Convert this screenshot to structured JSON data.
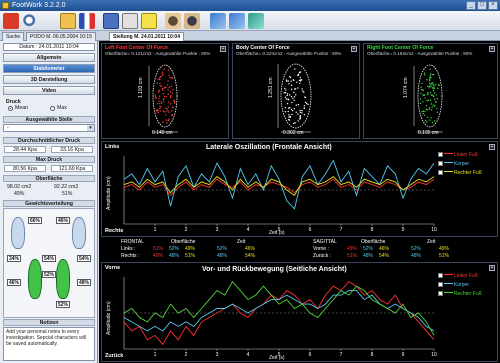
{
  "window": {
    "title": "FootWork 3.2.2.0"
  },
  "toolbar": {
    "icons": [
      "exit-icon",
      "search-icon",
      "folder-icon",
      "flag-icon",
      "disk-icon",
      "print-icon",
      "settings-icon",
      "people-icon",
      "people-icon",
      "export-icon",
      "import-icon",
      "sync-icon"
    ]
  },
  "tabs": [
    {
      "label": "Suche"
    },
    {
      "label": "PODO M. 06.05.2004 10:15"
    },
    {
      "label": "Stellung M. 24.01.2011 10:04"
    }
  ],
  "sidebar": {
    "date_label": "Datum : 24.01.2011 10:04",
    "buttons": {
      "allgemein": "Allgemein",
      "stabilometer": "Stabilometer",
      "darstellung3d": "3D Darstellung",
      "video": "Video"
    },
    "druck": {
      "label": "Druck",
      "options": [
        "Mean",
        "Max"
      ],
      "selected": "Mean"
    },
    "ausgewaehlte_stelle": {
      "label": "Ausgewählte Stelle",
      "value": "-"
    },
    "durchschnittlicher_druck": {
      "label": "Durchschnittlicher Druck",
      "left": "28.44 Kpa",
      "right": "33.16 Kpa"
    },
    "max_druck": {
      "label": "Max Druck",
      "left": "80.56 Kpa",
      "right": "121.69 Kpa"
    },
    "oberflaeche": {
      "label": "Oberfläche",
      "left": "98.02 cm2",
      "left_pct": "49%",
      "right": "92.22 cm2",
      "right_pct": "51%"
    },
    "gewichtsverteilung": {
      "label": "Gewichtsverteilung",
      "left_top": "66%",
      "right_top": "46%",
      "left_mid": "34%",
      "right_mid": "54%",
      "center_left": "54%",
      "center_right": "52%",
      "left_bottom": "46%",
      "right_bottom": "48%",
      "right_low": "52%"
    },
    "notizen": {
      "label": "Notizen",
      "text": "Add your personal notes to every investigation. Sepcial characters will be saved automatically."
    }
  },
  "cop_panels": [
    {
      "title": "Left Foot Center Of Force",
      "subtitle": "Oberfläche= 0.121cm2 - Ausgewählte Punkte : 90%",
      "color": "#ff3b3b",
      "xlabel": "0.149 cm",
      "ylabel": "1.193 cm"
    },
    {
      "title": "Body Center Of Force",
      "subtitle": "Oberfläche= 0.224cm2 - Ausgewählte Punkte : 90%",
      "color": "#ffffff",
      "xlabel": "0.302 cm",
      "ylabel": "1.251 cm"
    },
    {
      "title": "Right Foot Center Of Force",
      "subtitle": "Oberfläche= 0.163cm2 - Ausgewählte Punkte : 90%",
      "color": "#39d83f",
      "xlabel": "0.195 cm",
      "ylabel": "1.074 cm"
    }
  ],
  "lateral": {
    "title": "Laterale Oszillation (Frontale Ansicht)",
    "top_label": "Links",
    "bottom_label": "Rechts",
    "ylabel": "Amplitude (cm)",
    "xlabel": "Zeit (s)",
    "legend": [
      "Linker Fuß",
      "Korper",
      "Rechter Fuß"
    ]
  },
  "stats": {
    "frontal": "FRONTAL",
    "sagittal": "SAGITTAL",
    "oberflaeche": "Oberfläche",
    "zeit": "Zeit",
    "links": "Links :",
    "rechts": "Rechts :",
    "vorne": "Vorne :",
    "zuruck": "Zurück :",
    "links_vals": [
      "51%",
      "52%",
      "49%",
      "52%",
      "46%"
    ],
    "rechts_vals": [
      "49%",
      "48%",
      "51%",
      "48%",
      "54%"
    ],
    "vorne_vals": [
      "49%",
      "52%",
      "46%",
      "52%",
      "49%"
    ],
    "zuruck_vals": [
      "51%",
      "48%",
      "54%",
      "48%",
      "51%"
    ]
  },
  "sagittal": {
    "title": "Vor- und Rückbewegung (Seitliche Ansicht)",
    "top_label": "Vorne",
    "bottom_label": "Zurück",
    "ylabel": "Amplitude (cm)",
    "xlabel": "Zeit (s)",
    "legend": [
      "Linker Fuß",
      "Korper",
      "Rechter Fuß"
    ]
  },
  "chart_data": [
    {
      "type": "line",
      "title": "Laterale Oszillation (Frontale Ansicht)",
      "xlabel": "Zeit (s)",
      "ylabel": "Amplitude (cm)",
      "xlim": [
        0,
        10
      ],
      "x_ticks": [
        1,
        2,
        3,
        4,
        5,
        6,
        7,
        8,
        9,
        10
      ],
      "series": [
        {
          "name": "Linker Fuß",
          "color": "#ff3030",
          "values": [
            0.1,
            0.2,
            0.0,
            0.3,
            0.1,
            0.2,
            -0.2,
            0.1,
            0.3,
            0.0,
            0.2,
            0.1,
            0.4,
            0.2,
            0.1,
            0.3,
            0.0,
            0.2,
            0.1,
            0.3,
            0.2,
            0.1,
            -0.1,
            0.2,
            0.3,
            0.1,
            0.2,
            0.4,
            0.1,
            0.2,
            0.0,
            0.3,
            0.2,
            0.1,
            0.3,
            0.2,
            0.0,
            0.1,
            0.3,
            0.2,
            0.4
          ]
        },
        {
          "name": "Korper",
          "color": "#53c9f0",
          "values": [
            0.4,
            0.6,
            0.2,
            0.8,
            0.3,
            0.7,
            -0.6,
            0.5,
            0.9,
            0.1,
            0.6,
            0.3,
            1.0,
            0.5,
            -0.3,
            0.8,
            0.2,
            0.6,
            0.0,
            0.9,
            0.4,
            -0.4,
            -0.7,
            0.5,
            0.9,
            0.2,
            0.6,
            1.1,
            0.3,
            0.7,
            -0.2,
            0.8,
            0.5,
            0.2,
            0.9,
            0.6,
            -0.3,
            0.4,
            0.8,
            0.6,
            1.0
          ]
        },
        {
          "name": "Rechter Fuß",
          "color": "#e6e21a",
          "values": [
            0.2,
            0.3,
            0.1,
            0.4,
            0.2,
            0.3,
            -0.1,
            0.2,
            0.4,
            0.1,
            0.3,
            0.2,
            0.5,
            0.3,
            0.0,
            0.4,
            0.1,
            0.3,
            0.1,
            0.4,
            0.3,
            0.0,
            -0.2,
            0.3,
            0.4,
            0.2,
            0.3,
            0.5,
            0.2,
            0.3,
            0.1,
            0.4,
            0.3,
            0.2,
            0.4,
            0.3,
            0.0,
            0.2,
            0.4,
            0.3,
            0.5
          ]
        }
      ]
    },
    {
      "type": "line",
      "title": "Vor- und Rückbewegung (Seitliche Ansicht)",
      "xlabel": "Zeit (s)",
      "ylabel": "Amplitude (cm)",
      "xlim": [
        0,
        10
      ],
      "x_ticks": [
        1,
        2,
        3,
        4,
        5,
        6,
        7,
        8,
        9,
        10
      ],
      "series": [
        {
          "name": "Linker Fuß",
          "color": "#ff3030",
          "values": [
            -0.2,
            -0.4,
            -0.3,
            -0.6,
            -0.5,
            -0.7,
            -0.4,
            -0.6,
            -0.3,
            -0.5,
            -0.2,
            -0.1,
            0.0,
            0.1,
            0.2,
            0.0,
            -0.1,
            0.1,
            0.2,
            0.4,
            0.3,
            0.5,
            0.4,
            0.2,
            0.3,
            0.1,
            0.4,
            0.6,
            0.5,
            0.7,
            0.6,
            0.4,
            0.5,
            0.3,
            0.2,
            0.4,
            0.1,
            0.0,
            -0.2,
            -0.4,
            -0.6
          ]
        },
        {
          "name": "Korper",
          "color": "#53c9f0",
          "values": [
            -0.1,
            -0.2,
            -0.3,
            -0.4,
            -0.3,
            -0.4,
            -0.2,
            -0.3,
            -0.2,
            -0.3,
            -0.1,
            0.0,
            0.1,
            0.1,
            0.2,
            0.1,
            0.0,
            0.1,
            0.2,
            0.3,
            0.3,
            0.4,
            0.3,
            0.2,
            0.2,
            0.1,
            0.2,
            0.4,
            0.4,
            0.5,
            0.5,
            0.3,
            0.4,
            0.2,
            0.1,
            0.2,
            0.1,
            0.0,
            -0.1,
            -0.3,
            -0.4
          ]
        },
        {
          "name": "Rechter Fuß",
          "color": "#4fd23a",
          "values": [
            0.0,
            0.1,
            -0.1,
            -0.2,
            0.0,
            -0.1,
            0.2,
            0.0,
            0.1,
            -0.1,
            0.1,
            0.3,
            0.5,
            0.4,
            0.7,
            0.5,
            0.3,
            0.4,
            0.6,
            0.4,
            0.2,
            0.3,
            0.1,
            0.2,
            0.0,
            -0.1,
            0.1,
            0.3,
            0.5,
            0.4,
            0.6,
            0.5,
            0.3,
            0.2,
            0.1,
            0.0,
            0.2,
            -0.1,
            0.0,
            -0.2,
            -0.5
          ]
        }
      ]
    }
  ]
}
